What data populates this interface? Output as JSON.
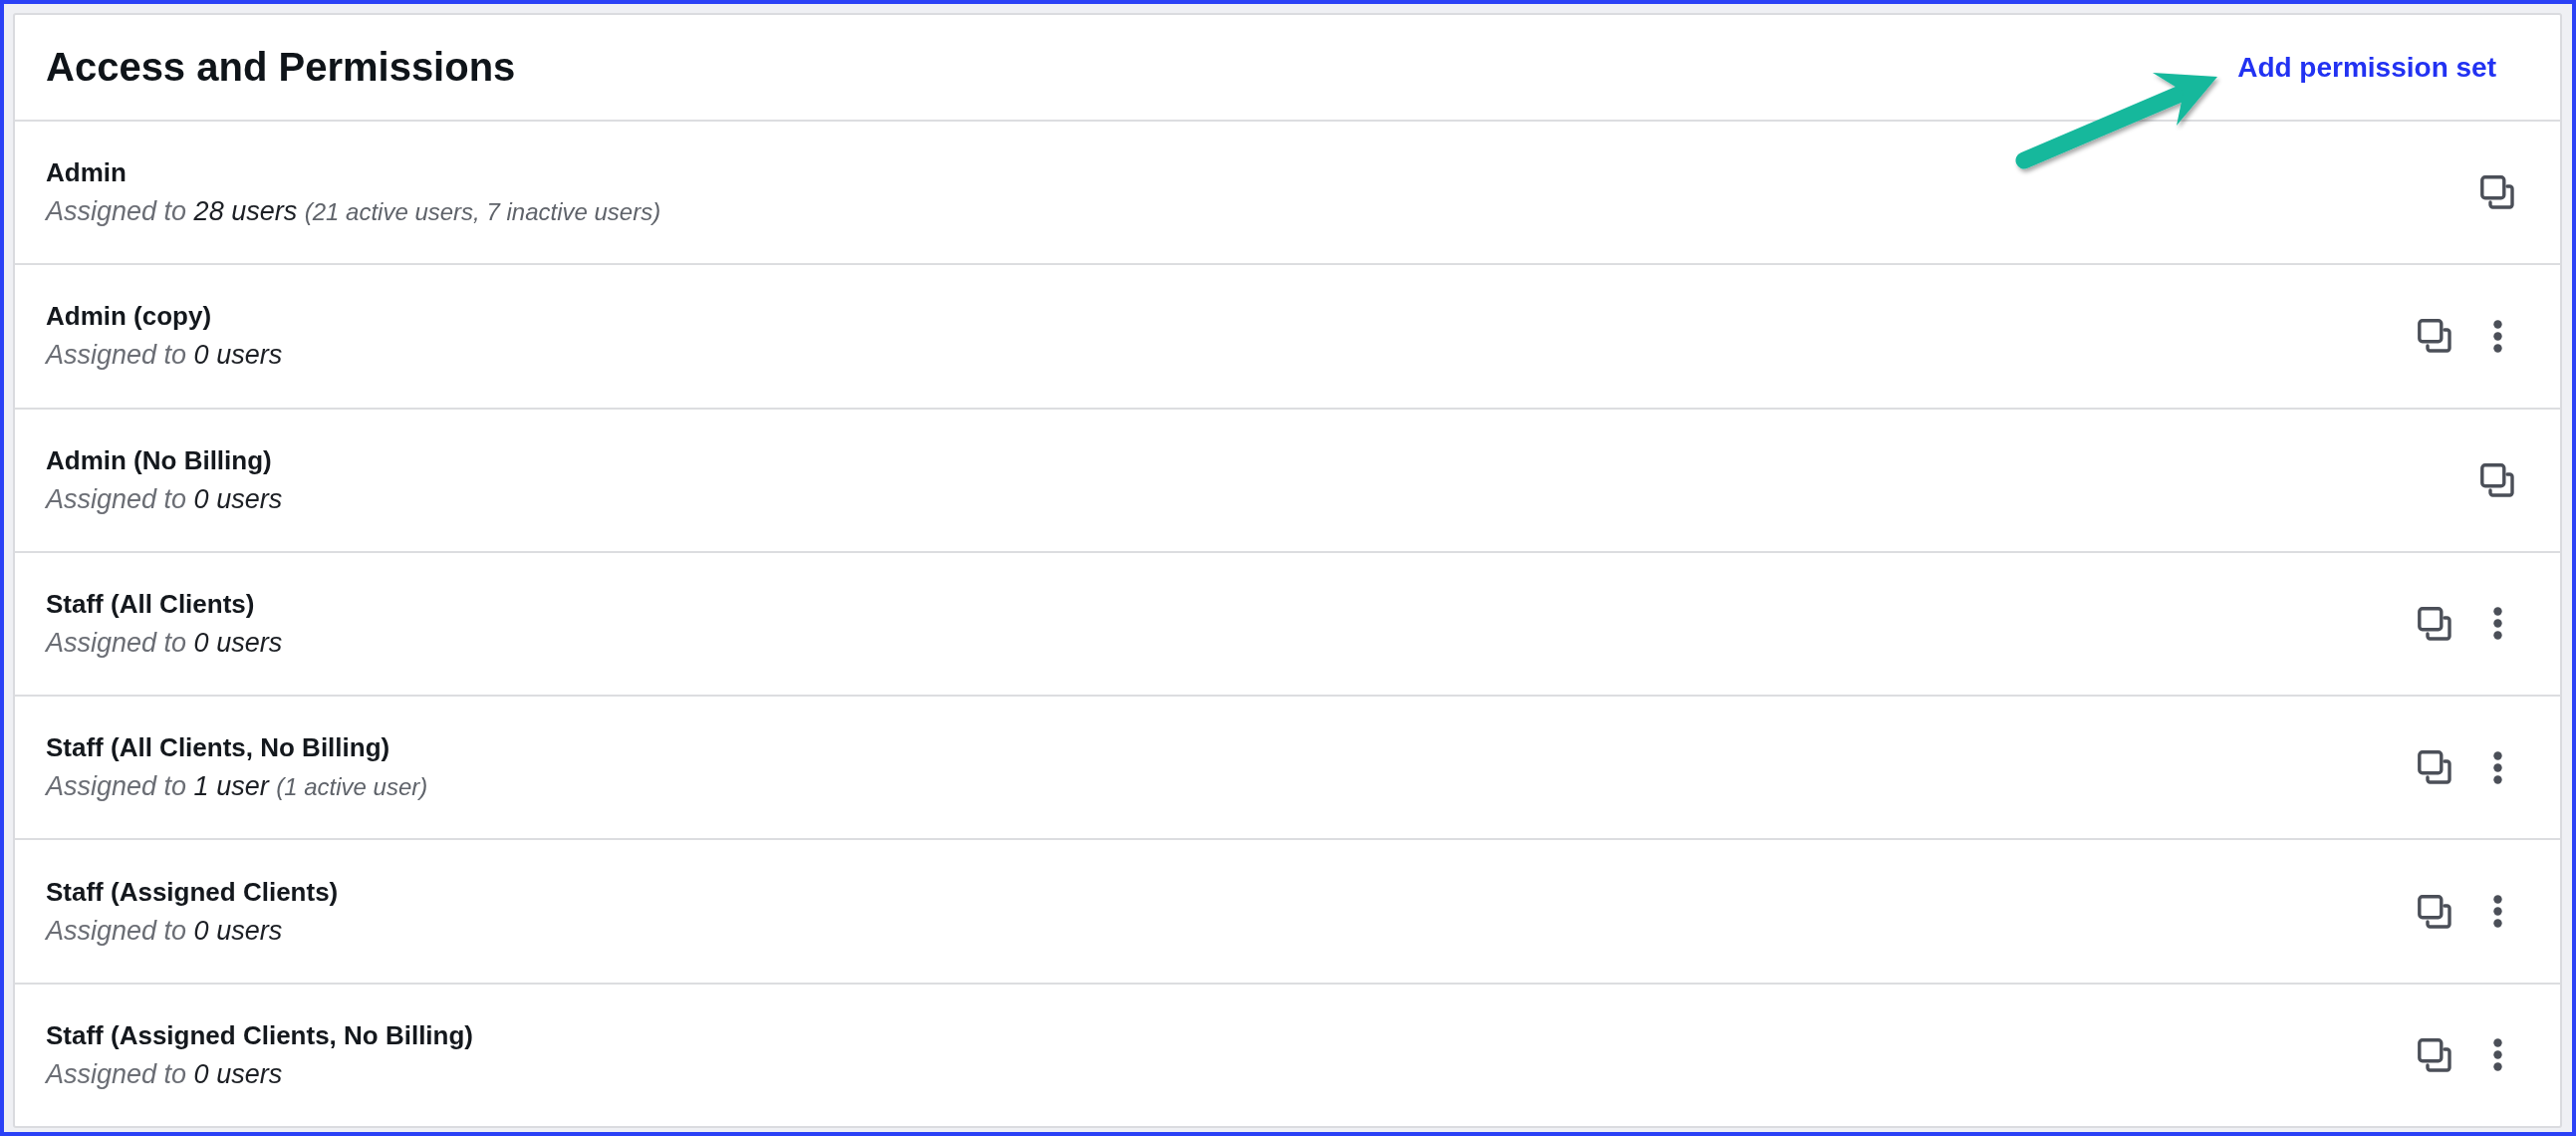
{
  "header": {
    "title": "Access and Permissions",
    "action": "Add permission set"
  },
  "permission_sets": [
    {
      "name": "Admin",
      "assigned_label": "Assigned to",
      "count": "28 users",
      "detail": "(21 active users, 7 inactive users)",
      "has_menu": false
    },
    {
      "name": "Admin (copy)",
      "assigned_label": "Assigned to",
      "count": "0 users",
      "has_menu": true
    },
    {
      "name": "Admin (No Billing)",
      "assigned_label": "Assigned to",
      "count": "0 users",
      "has_menu": false
    },
    {
      "name": "Staff (All Clients)",
      "assigned_label": "Assigned to",
      "count": "0 users",
      "has_menu": true
    },
    {
      "name": "Staff (All Clients, No Billing)",
      "assigned_label": "Assigned to",
      "count": "1 user",
      "detail": "(1 active user)",
      "has_menu": true
    },
    {
      "name": "Staff (Assigned Clients)",
      "assigned_label": "Assigned to",
      "count": "0 users",
      "has_menu": true
    },
    {
      "name": "Staff (Assigned Clients, No Billing)",
      "assigned_label": "Assigned to",
      "count": "0 users",
      "has_menu": true
    }
  ]
}
